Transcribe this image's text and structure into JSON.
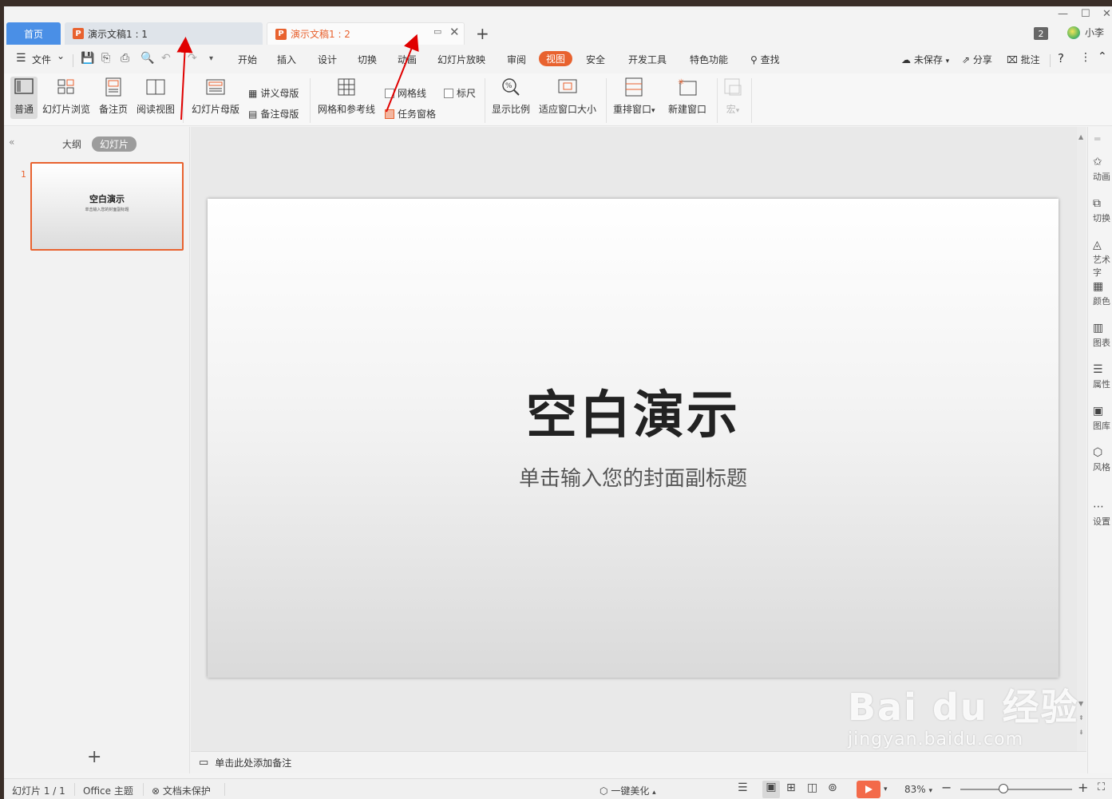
{
  "tabs": {
    "home": "首页",
    "doc1": "演示文稿1 : 1",
    "doc2": "演示文稿1 : 2",
    "new_tab": "+",
    "badge": "2",
    "user": "小李"
  },
  "menu": {
    "file": "文件",
    "items": [
      "开始",
      "插入",
      "设计",
      "切换",
      "动画",
      "幻灯片放映",
      "审阅",
      "视图",
      "安全",
      "开发工具",
      "特色功能"
    ],
    "active": "视图",
    "search": "查找",
    "unsaved": "未保存",
    "share": "分享",
    "comment": "批注",
    "help": "?"
  },
  "ribbon": {
    "normal": "普通",
    "slide_sorter": "幻灯片浏览",
    "notes_page": "备注页",
    "reading_view": "阅读视图",
    "slide_master": "幻灯片母版",
    "handout_master": "讲义母版",
    "notes_master": "备注母版",
    "grid_guides": "网格和参考线",
    "gridlines": "网格线",
    "ruler": "标尺",
    "task_pane": "任务窗格",
    "zoom": "显示比例",
    "fit_window": "适应窗口大小",
    "rearrange": "重排窗口",
    "new_window": "新建窗口",
    "macro": "宏"
  },
  "left_panel": {
    "outline_tab": "大纲",
    "slides_tab": "幻灯片",
    "slide_number": "1",
    "thumb_title": "空白演示",
    "thumb_sub": "单击输入您的封面副标题",
    "add": "+"
  },
  "slide": {
    "title": "空白演示",
    "subtitle": "单击输入您的封面副标题"
  },
  "right_bar": [
    "动画",
    "切换",
    "艺术字",
    "颜色",
    "图表",
    "属性",
    "图库",
    "风格",
    "设置"
  ],
  "notes": {
    "placeholder": "单击此处添加备注"
  },
  "status": {
    "slide_count": "幻灯片 1 / 1",
    "theme": "Office 主题",
    "protection": "文档未保护",
    "beautify": "一键美化",
    "zoom": "83%"
  },
  "watermark": {
    "brand": "Bai du 经验",
    "url": "jingyan.baidu.com"
  },
  "colors": {
    "accent": "#e8622f",
    "home_tab": "#4a8fe6",
    "annotation_arrow": "#e00000"
  }
}
